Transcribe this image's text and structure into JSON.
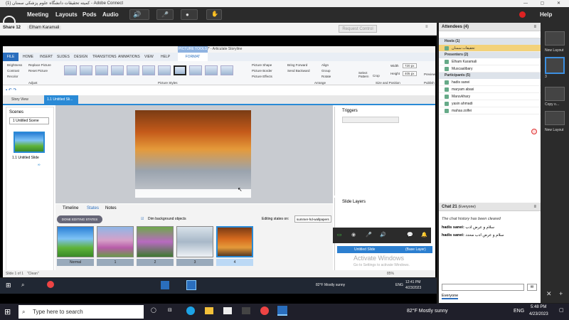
{
  "window": {
    "title": "(1) کمیته تحقیقات دانشگاه علوم پزشکی سمنان - Adobe Connect"
  },
  "menu": {
    "items": [
      "Meeting",
      "Layouts",
      "Pods",
      "Audio"
    ],
    "help": "Help"
  },
  "share": {
    "title": "Share 12",
    "presenter": "Elham Karamali",
    "request_control": "Request Control"
  },
  "storyline": {
    "title": "Untitled* - Articulate Storyline",
    "context_tab": "PICTURE TOOLS",
    "tabs": [
      "FILE",
      "HOME",
      "INSERT",
      "SLIDES",
      "DESIGN",
      "TRANSITIONS",
      "ANIMATIONS",
      "VIEW",
      "HELP",
      "FORMAT"
    ],
    "adjust": [
      "Brightness",
      "Replace Picture",
      "Contrast",
      "Reset Picture",
      "Recolor"
    ],
    "groups": [
      "Adjust",
      "Picture Styles",
      "Arrange",
      "Size and Position",
      "Publish"
    ],
    "shape": [
      "Picture Shape",
      "Picture Border",
      "Picture Effects"
    ],
    "arrange": [
      "Bring Forward",
      "Send Backward",
      "Align",
      "Group",
      "Rotate"
    ],
    "crop": "Crop",
    "select": "Select Pattern",
    "size": {
      "height": "Height",
      "height_val": "405 px",
      "width": "Width",
      "width_val": "720 px"
    },
    "preview": "Preview",
    "view_tabs": [
      "Story View",
      "1.1 Untitled Sli..."
    ],
    "scenes_title": "Scenes",
    "scene_select": "1 Untitled Scene",
    "scene_slide": "1.1 Untitled Slide",
    "triggers": "Triggers",
    "slide_layers": "Slide Layers",
    "layer_name": "Untitled Slide",
    "layer_base": "(Base Layer)",
    "activate": "Activate Windows",
    "activate_sub": "Go to Settings to activate Windows.",
    "bottom_tabs": [
      "Timeline",
      "States",
      "Notes"
    ],
    "done": "DONE EDITING STATES",
    "dim": "Dim background objects",
    "editing_label": "Editing states on:",
    "editing_val": "summer-hd-wallpapers",
    "states": [
      "Normal",
      "1",
      "2",
      "3",
      "4"
    ],
    "status": {
      "slide": "Slide 1 of 1",
      "name": "\"Clean\"",
      "zoom": "85%"
    }
  },
  "inner_task": {
    "weather": "82°F Mostly sunny",
    "time": "12:41 PM",
    "date": "4/23/2023",
    "lang": "ENG"
  },
  "attendees": {
    "title": "Attendees (4)",
    "hosts": "Hosts (1)",
    "host_names": [
      "تحقیقات سمنان"
    ],
    "presenters": "Presenters (2)",
    "presenter_names": [
      "Elham Karamali",
      "Muscaalibary"
    ],
    "participants": "Participants (5)",
    "participant_names": [
      "hadis sanei",
      "maryam abasi",
      "Maruvkhary",
      "yasin ahmadi",
      "mahsa zolfei"
    ]
  },
  "chat": {
    "title": "Chat 21",
    "scope": "(Everyone)",
    "cleared": "The chat history has been cleared",
    "messages": [
      {
        "from": "hadis sanei:",
        "text": "سلام و عرض ادب"
      },
      {
        "from": "hadis sanei:",
        "text": "سلام و عرض ادب محدد"
      }
    ],
    "tab": "Everyone"
  },
  "layouts": [
    "New Layout",
    "3",
    "Copy o...",
    "New Layout"
  ],
  "taskbar": {
    "search": "Type here to search",
    "weather": "82°F Mostly sunny",
    "time": "5:48 PM",
    "date": "4/23/2023",
    "lang": "ENG"
  }
}
